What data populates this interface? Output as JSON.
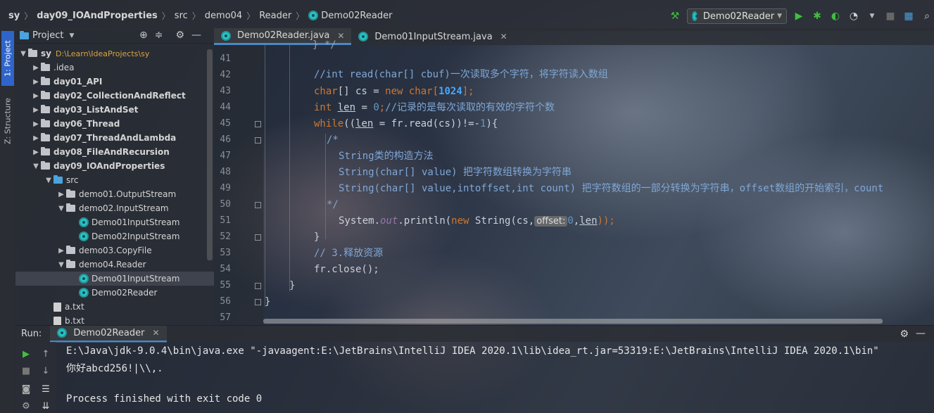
{
  "navbar": {
    "crumbs": [
      "sy",
      "day09_IOAndProperties",
      "src",
      "demo04",
      "Reader",
      "Demo02Reader"
    ]
  },
  "toolbar": {
    "run_config": "Demo02Reader",
    "icons": [
      "hammer-icon",
      "run-icon",
      "debug-icon",
      "coverage-icon",
      "profile-icon",
      "stop-icon",
      "project-structure-icon",
      "search-icon"
    ]
  },
  "left_strip": {
    "project_tab": "1: Project",
    "structure_tab": "Z: Structure"
  },
  "project_panel": {
    "title": "Project",
    "tree": [
      {
        "label": "sy",
        "path": "D:\\Learn\\IdeaProjects\\sy",
        "indent": 0,
        "arrow": "open",
        "kind": "folder",
        "bold": true
      },
      {
        "label": ".idea",
        "indent": 1,
        "arrow": "closed",
        "kind": "folder",
        "bold": false
      },
      {
        "label": "day01_API",
        "indent": 1,
        "arrow": "closed",
        "kind": "folder",
        "bold": true
      },
      {
        "label": "day02_CollectionAndReflect",
        "indent": 1,
        "arrow": "closed",
        "kind": "folder",
        "bold": true
      },
      {
        "label": "day03_ListAndSet",
        "indent": 1,
        "arrow": "closed",
        "kind": "folder",
        "bold": true
      },
      {
        "label": "day06_Thread",
        "indent": 1,
        "arrow": "closed",
        "kind": "folder",
        "bold": true
      },
      {
        "label": "day07_ThreadAndLambda",
        "indent": 1,
        "arrow": "closed",
        "kind": "folder",
        "bold": true
      },
      {
        "label": "day08_FileAndRecursion",
        "indent": 1,
        "arrow": "closed",
        "kind": "folder",
        "bold": true
      },
      {
        "label": "day09_IOAndProperties",
        "indent": 1,
        "arrow": "open",
        "kind": "folder",
        "bold": true
      },
      {
        "label": "src",
        "indent": 2,
        "arrow": "open",
        "kind": "src",
        "bold": false
      },
      {
        "label": "demo01.OutputStream",
        "indent": 3,
        "arrow": "closed",
        "kind": "package",
        "bold": false
      },
      {
        "label": "demo02.InputStream",
        "indent": 3,
        "arrow": "open",
        "kind": "package",
        "bold": false
      },
      {
        "label": "Demo01InputStream",
        "indent": 4,
        "arrow": "none",
        "kind": "class",
        "bold": false
      },
      {
        "label": "Demo02InputStream",
        "indent": 4,
        "arrow": "none",
        "kind": "class",
        "bold": false
      },
      {
        "label": "demo03.CopyFile",
        "indent": 3,
        "arrow": "closed",
        "kind": "package",
        "bold": false
      },
      {
        "label": "demo04.Reader",
        "indent": 3,
        "arrow": "open",
        "kind": "package",
        "bold": false
      },
      {
        "label": "Demo01InputStream",
        "indent": 4,
        "arrow": "none",
        "kind": "class",
        "bold": false,
        "selected": true
      },
      {
        "label": "Demo02Reader",
        "indent": 4,
        "arrow": "none",
        "kind": "class",
        "bold": false
      },
      {
        "label": "a.txt",
        "indent": 2,
        "arrow": "none",
        "kind": "file",
        "bold": false
      },
      {
        "label": "b.txt",
        "indent": 2,
        "arrow": "none",
        "kind": "file",
        "bold": false
      }
    ]
  },
  "editor": {
    "tabs": [
      {
        "label": "Demo02Reader.java",
        "active": true
      },
      {
        "label": "Demo01InputStream.java",
        "active": false
      }
    ],
    "top_partial": "} */",
    "line_numbers": [
      "41",
      "42",
      "43",
      "44",
      "45",
      "46",
      "47",
      "48",
      "49",
      "50",
      "51",
      "52",
      "53",
      "54",
      "55",
      "56",
      "57"
    ],
    "code": {
      "l42": "//int read(char[] cbuf)一次读取多个字符，将字符读入数组",
      "l43_a": "char",
      "l43_b": "[] cs = ",
      "l43_c": "new char",
      "l43_d": "[",
      "l43_e": "1024",
      "l43_f": "];",
      "l44_a": "int",
      "l44_b": "len",
      "l44_c": " = ",
      "l44_d": "0",
      "l44_e": ";",
      "l44_f": "//记录的是每次读取的有效的字符个数",
      "l45_a": "while",
      "l45_b": "((",
      "l45_c": "len",
      "l45_d": " = fr.read(cs))!=-",
      "l45_e": "1",
      "l45_f": "){",
      "l46": "/*",
      "l47": "String类的构造方法",
      "l48": "String(char[] value) 把字符数组转换为字符串",
      "l49": "String(char[] value,intoffset,int count) 把字符数组的一部分转换为字符串，offset数组的开始索引，count",
      "l50": "*/",
      "l51_a": "System.",
      "l51_b": "out",
      "l51_c": ".println(",
      "l51_d": "new",
      "l51_e": " String(cs,",
      "l51_hint": "offset:",
      "l51_f": "0",
      "l51_g": ",",
      "l51_h": "len",
      "l51_i": "));",
      "l52": "}",
      "l53": "// 3.释放资源",
      "l54": "fr.close();",
      "l55": "}",
      "l56": "}"
    }
  },
  "run_panel": {
    "label": "Run:",
    "tab": "Demo02Reader",
    "console": [
      "E:\\Java\\jdk-9.0.4\\bin\\java.exe \"-javaagent:E:\\JetBrains\\IntelliJ IDEA 2020.1\\lib\\idea_rt.jar=53319:E:\\JetBrains\\IntelliJ IDEA 2020.1\\bin\"",
      "你好abcd256!|\\\\,.",
      "",
      "Process finished with exit code 0"
    ]
  },
  "colors": {
    "keyword": "#cc7832",
    "comment": "#7fa7d6",
    "number": "#6897bb",
    "accent": "#2f65ca",
    "run_green": "#3fbf3f"
  }
}
